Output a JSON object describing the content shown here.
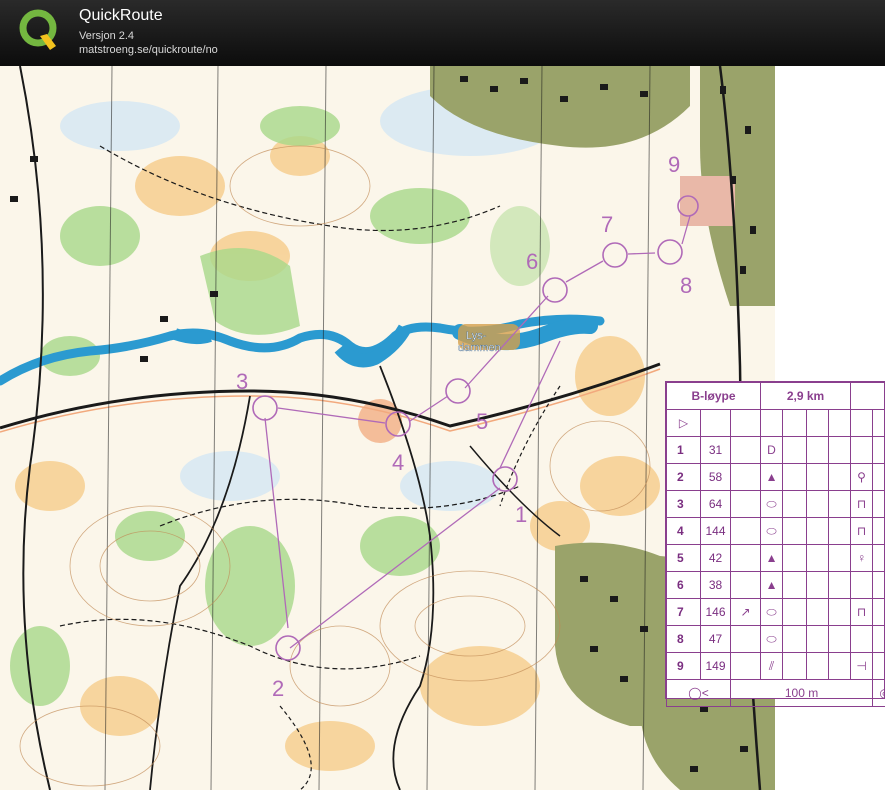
{
  "app": {
    "title": "QuickRoute",
    "version": "Versjon 2.4",
    "url": "matstroeng.se/quickroute/no"
  },
  "map": {
    "lake_label": "Lys-\ndammen",
    "control_numbers": [
      "1",
      "2",
      "3",
      "4",
      "5",
      "6",
      "7",
      "8",
      "9"
    ]
  },
  "legend": {
    "course": "B-løype",
    "length": "2,9 km",
    "scale_length": "100 m",
    "controls": [
      {
        "num": "1",
        "code": "31",
        "symbol": "D"
      },
      {
        "num": "2",
        "code": "58",
        "symbol": "▲"
      },
      {
        "num": "3",
        "code": "64",
        "symbol": "⬭"
      },
      {
        "num": "4",
        "code": "144",
        "symbol": "⬭"
      },
      {
        "num": "5",
        "code": "42",
        "symbol": "▲"
      },
      {
        "num": "6",
        "code": "38",
        "symbol": "▲"
      },
      {
        "num": "7",
        "code": "146",
        "symbol": "⬭"
      },
      {
        "num": "8",
        "code": "47",
        "symbol": "⬭"
      },
      {
        "num": "9",
        "code": "149",
        "symbol": "⫽"
      }
    ]
  },
  "colors": {
    "course": "#b06ab8",
    "water": "#2b9ad0",
    "open": "#f6c984",
    "vegetation": "#a8d98a",
    "urban": "#9aa36a"
  }
}
